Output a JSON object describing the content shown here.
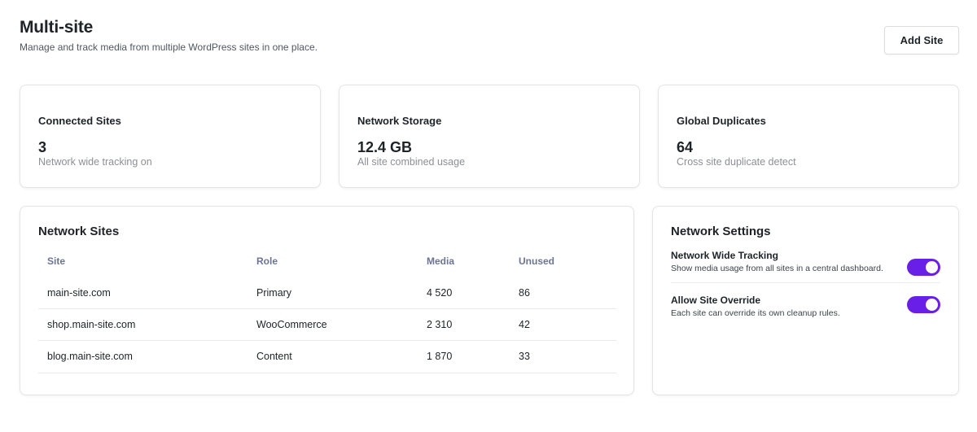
{
  "header": {
    "title": "Multi-site",
    "subtitle": "Manage and track media from multiple WordPress sites in one place.",
    "add_site_label": "Add Site"
  },
  "stats": [
    {
      "label": "Connected Sites",
      "value": "3",
      "desc": "Network wide tracking on"
    },
    {
      "label": "Network Storage",
      "value": "12.4 GB",
      "desc": "All site combined usage"
    },
    {
      "label": "Global Duplicates",
      "value": "64",
      "desc": "Cross site duplicate detect"
    }
  ],
  "network_sites": {
    "title": "Network Sites",
    "columns": [
      "Site",
      "Role",
      "Media",
      "Unused"
    ],
    "rows": [
      [
        "main-site.com",
        "Primary",
        "4 520",
        "86"
      ],
      [
        "shop.main-site.com",
        "WooCommerce",
        "2 310",
        "42"
      ],
      [
        "blog.main-site.com",
        "Content",
        "1 870",
        "33"
      ]
    ]
  },
  "network_settings": {
    "title": "Network Settings",
    "items": [
      {
        "title": "Network Wide Tracking",
        "desc": "Show media usage from all sites in a central dashboard.",
        "enabled": true
      },
      {
        "title": "Allow Site Override",
        "desc": "Each site can override its own cleanup rules.",
        "enabled": true
      }
    ]
  },
  "colors": {
    "accent": "#6a1fe8",
    "header_text": "#6c7493"
  }
}
